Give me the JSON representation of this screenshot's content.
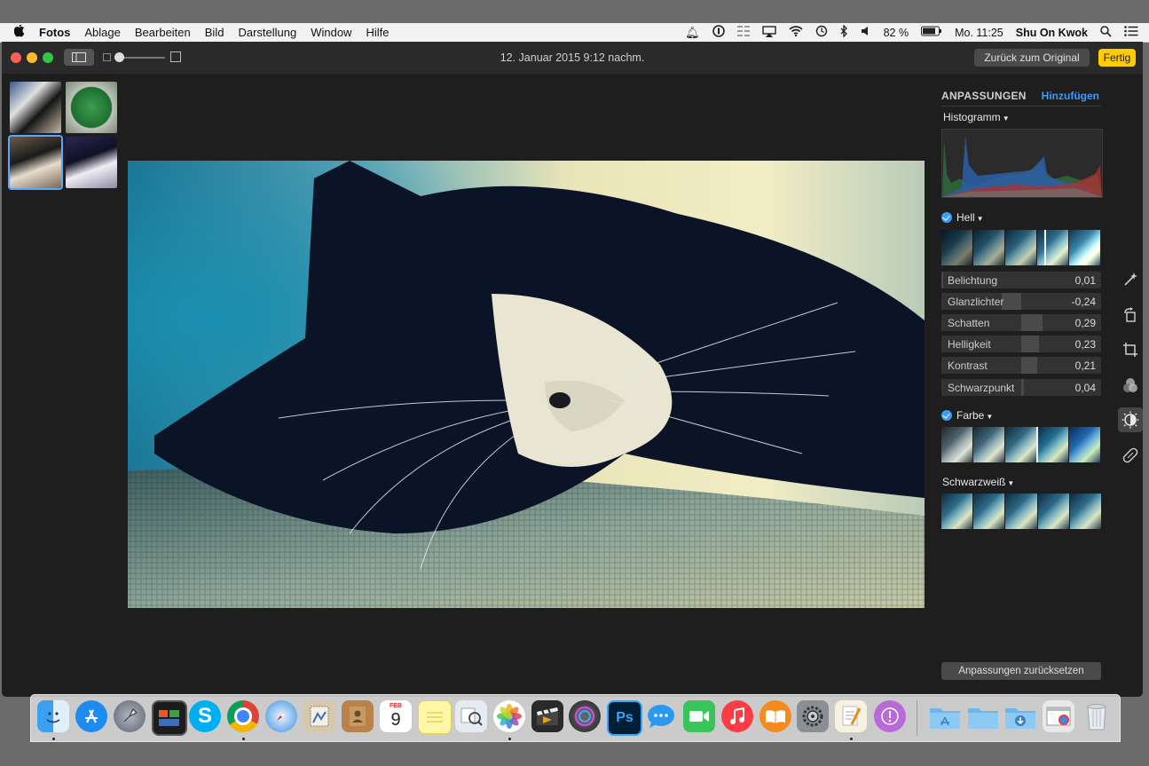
{
  "menubar": {
    "apple": "",
    "items": [
      "Fotos",
      "Ablage",
      "Bearbeiten",
      "Bild",
      "Darstellung",
      "Window",
      "Hilfe"
    ],
    "battery": "82 %",
    "clock": "Mo. 11:25",
    "user": "Shu On Kwok"
  },
  "window": {
    "title": "12. Januar 2015 9:12 nachm.",
    "revert_label": "Zurück zum Original",
    "done_label": "Fertig"
  },
  "panel": {
    "tab_adjust": "ANPASSUNGEN",
    "tab_add": "Hinzufügen",
    "histogram_label": "Histogramm",
    "light_label": "Hell",
    "color_label": "Farbe",
    "bw_label": "Schwarzweiß",
    "reset_label": "Anpassungen zurücksetzen",
    "sliders": [
      {
        "name": "Belichtung",
        "value": "0,01"
      },
      {
        "name": "Glanzlichter",
        "value": "-0,24"
      },
      {
        "name": "Schatten",
        "value": "0,29"
      },
      {
        "name": "Helligkeit",
        "value": "0,23"
      },
      {
        "name": "Kontrast",
        "value": "0,21"
      },
      {
        "name": "Schwarzpunkt",
        "value": "0,04"
      }
    ]
  },
  "colors": {
    "accent": "#3b9cff",
    "done_button": "#ffcc00"
  },
  "tools": [
    "magic-wand-icon",
    "rotate-icon",
    "crop-icon",
    "filters-icon",
    "adjust-icon",
    "retouch-icon"
  ],
  "dock": {
    "calendar_month": "FEB",
    "calendar_day": "9",
    "photoshop": "Ps",
    "skype": "S"
  }
}
